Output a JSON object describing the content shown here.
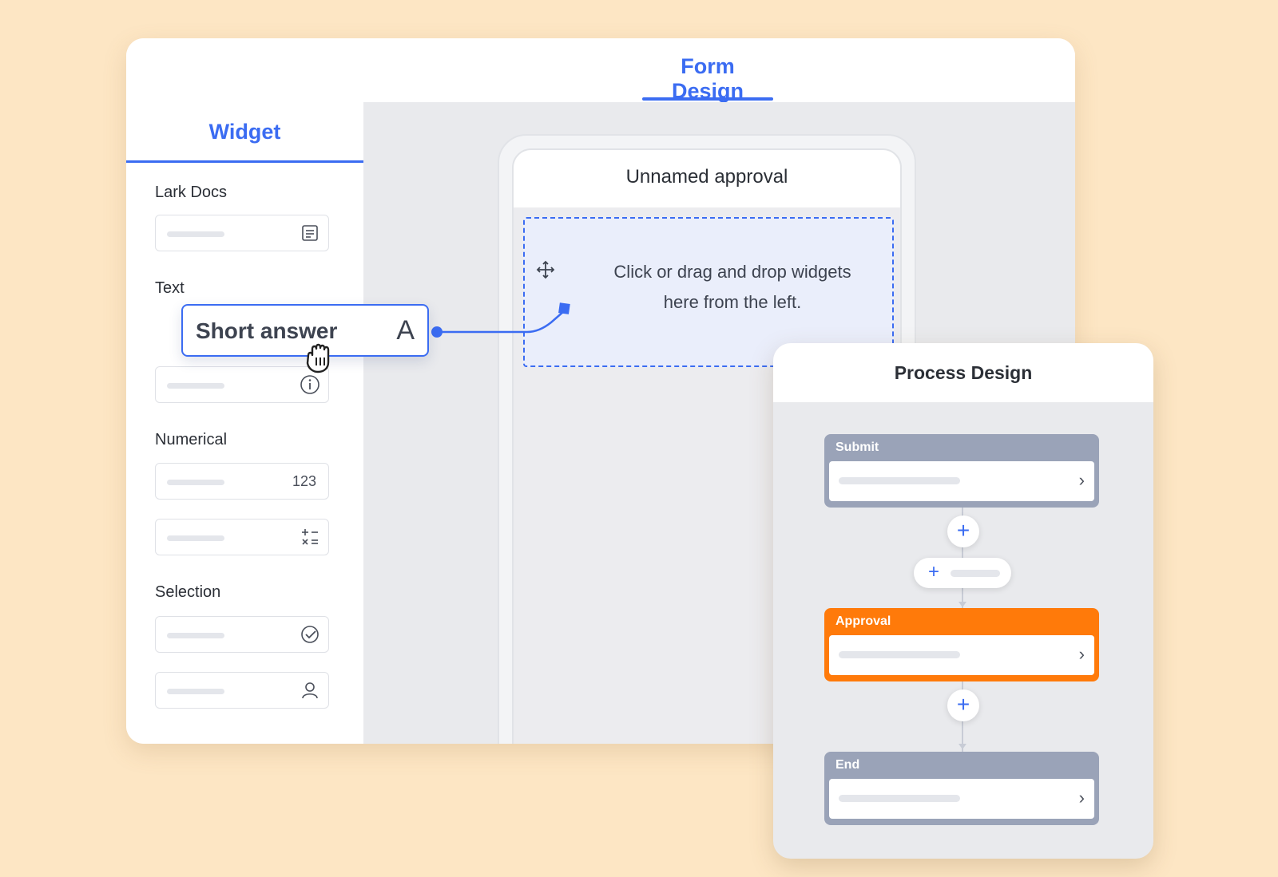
{
  "form_design": {
    "tab_label": "Form Design",
    "sidebar": {
      "title": "Widget",
      "sections": {
        "lark_docs": "Lark Docs",
        "text": "Text",
        "numerical": "Numerical",
        "selection": "Selection"
      },
      "number_icon_text": "123"
    },
    "phone": {
      "title": "Unnamed approval",
      "drop_line1": "Click or drag and drop widgets",
      "drop_line2": "here from the left."
    },
    "dragged_widget": {
      "label": "Short answer",
      "icon_text": "A"
    }
  },
  "process_design": {
    "title": "Process Design",
    "nodes": [
      {
        "title": "Submit",
        "color": "#9aa3b8"
      },
      {
        "title": "Approval",
        "color": "#ff7a0a"
      },
      {
        "title": "End",
        "color": "#9aa3b8"
      }
    ]
  },
  "colors": {
    "accent": "#3b6cf2",
    "background": "#fde6c4",
    "approval": "#ff7a0a",
    "node_gray": "#9aa3b8"
  }
}
